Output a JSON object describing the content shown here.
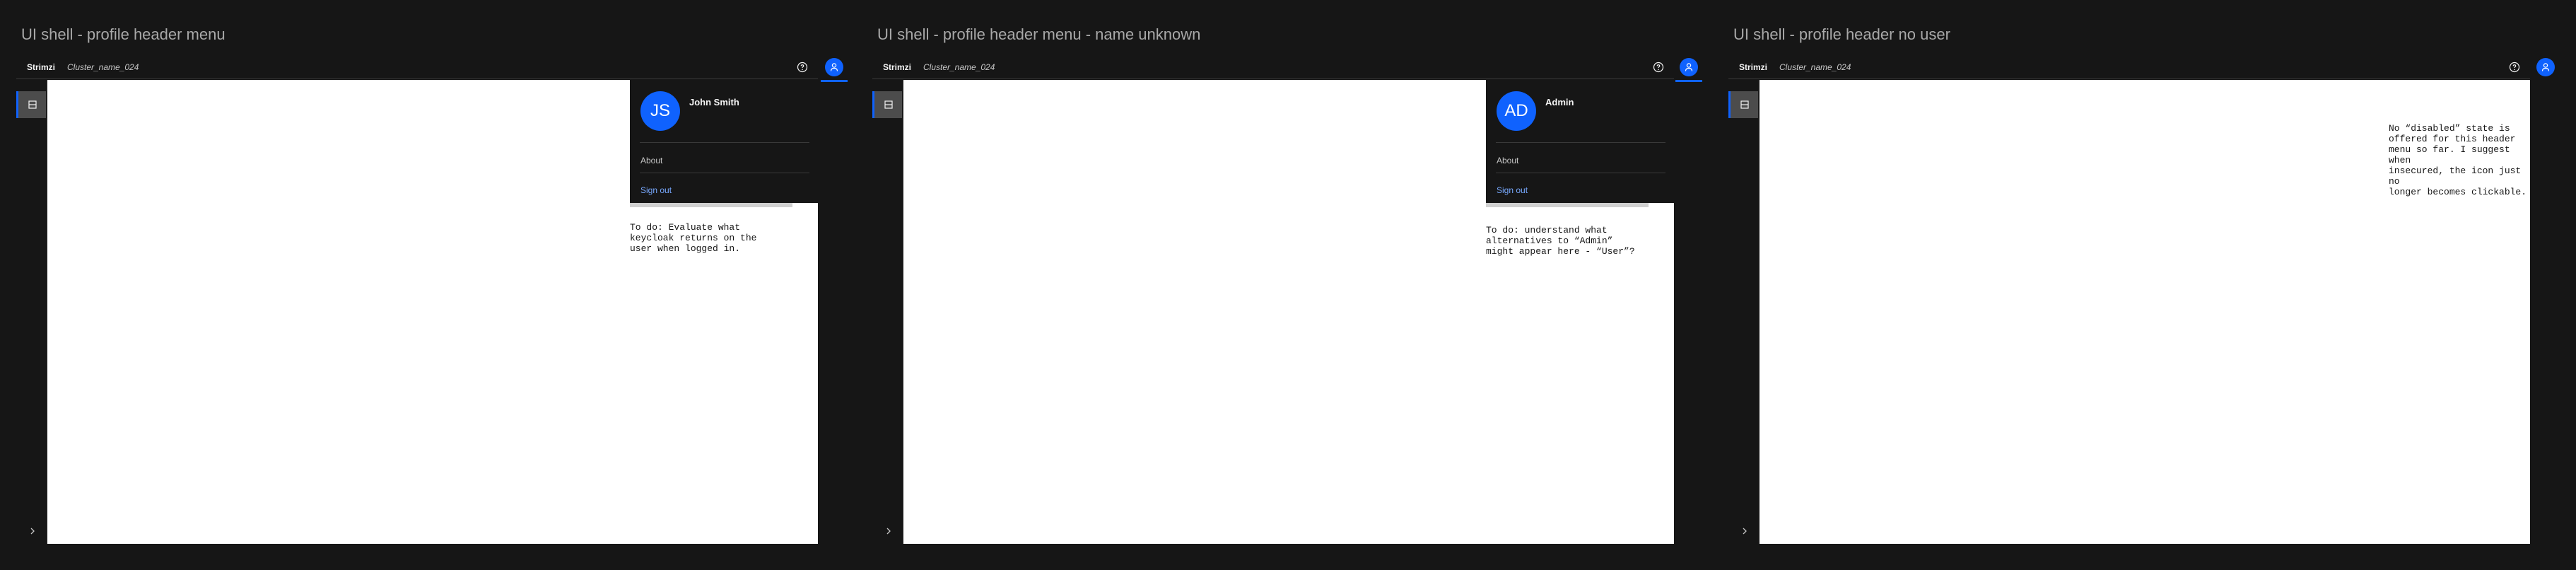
{
  "panels": [
    {
      "frame_title": "UI shell - profile header menu",
      "header": {
        "brand": "Strimzi",
        "cluster_name": "Cluster_name_024"
      },
      "menu": {
        "initials": "JS",
        "user_name": "John Smith",
        "items": [
          {
            "label": "About"
          },
          {
            "label": "Sign out"
          }
        ]
      },
      "note": "To do: Evaluate what\nkeycloak returns on the\nuser when logged in."
    },
    {
      "frame_title": "UI shell - profile header menu - name unknown",
      "header": {
        "brand": "Strimzi",
        "cluster_name": "Cluster_name_024"
      },
      "menu": {
        "initials": "AD",
        "user_name": "Admin",
        "items": [
          {
            "label": "About"
          },
          {
            "label": "Sign out"
          }
        ]
      },
      "note": "To do: understand what\nalternatives to “Admin”\nmight appear here - “User”?"
    },
    {
      "frame_title": "UI shell - profile header no user",
      "header": {
        "brand": "Strimzi",
        "cluster_name": "Cluster_name_024"
      },
      "note": "No “disabled” state is\noffered for this header\nmenu so far. I suggest when\ninsecured, the icon just no\nlonger becomes clickable."
    }
  ],
  "colors": {
    "accent": "#0f62fe",
    "background": "#161616",
    "content": "#ffffff",
    "sign_out": "#78a9ff"
  },
  "icons": {
    "help": "help-icon",
    "user": "user-avatar-icon",
    "nav": "server-icon",
    "expand": "chevron-right-icon"
  }
}
